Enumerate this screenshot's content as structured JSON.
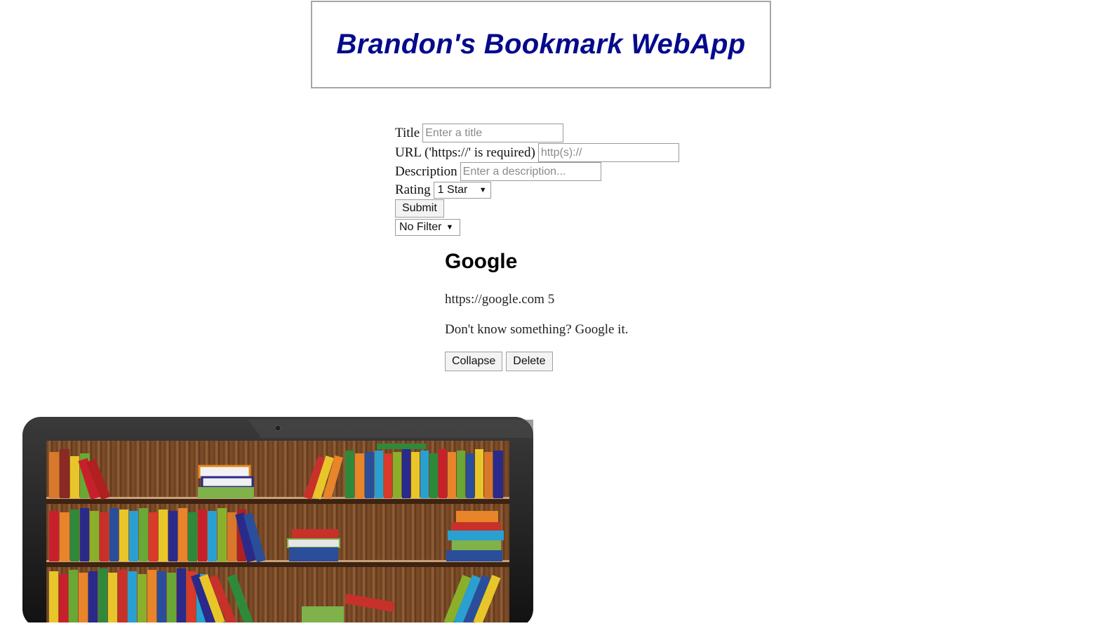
{
  "header": {
    "title": "Brandon's Bookmark WebApp"
  },
  "form": {
    "title_label": "Title",
    "title_placeholder": "Enter a title",
    "url_label": "URL ('https://' is required)",
    "url_placeholder": "http(s)://",
    "description_label": "Description",
    "description_placeholder": "Enter a description...",
    "rating_label": "Rating",
    "rating_selected": "1 Star",
    "submit_label": "Submit",
    "filter_selected": "No Filter"
  },
  "bookmark": {
    "title": "Google",
    "url": "https://google.com",
    "rating": "5",
    "description": "Don't know something? Google it.",
    "collapse_label": "Collapse",
    "delete_label": "Delete"
  },
  "colors": {
    "title": "#050a8c",
    "border": "#a6a6a6"
  },
  "icons": [
    "laptop-bookshelf-illustration",
    "chevron-down-icon"
  ]
}
